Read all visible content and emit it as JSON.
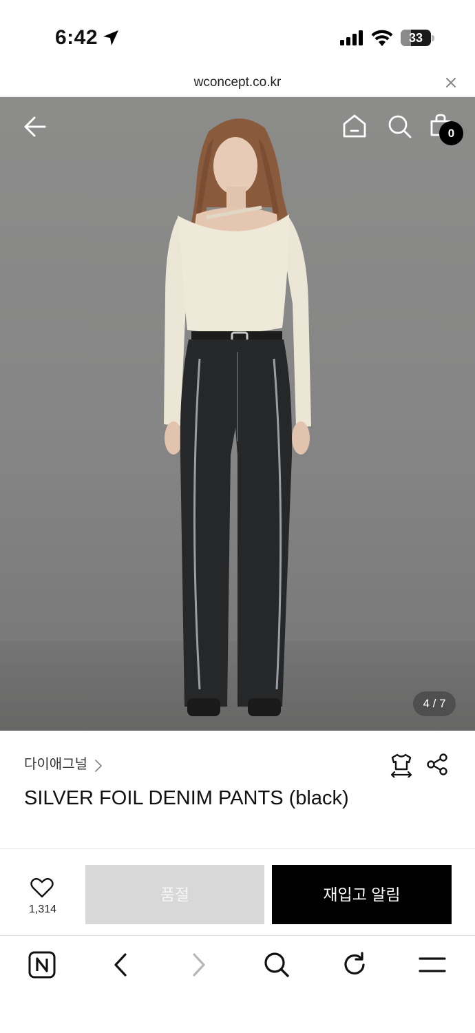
{
  "status_bar": {
    "time": "6:42",
    "battery_level": "33",
    "battery_fraction": 0.33
  },
  "browser": {
    "url": "wconcept.co.kr"
  },
  "hero": {
    "page_indicator": "4 / 7",
    "cart_count": "0",
    "image_alt": "Model wearing cream asymmetric knit top and black silver-foil wide denim pants"
  },
  "product": {
    "brand": "다이애그널",
    "name": "SILVER FOIL DENIM PANTS (black)"
  },
  "actions": {
    "wish_count": "1,314",
    "soldout_label": "품절",
    "restock_label": "재입고 알림"
  },
  "icons": {
    "back": "arrow-left-icon",
    "home": "home-icon",
    "search": "search-icon",
    "cart": "shopping-bag-icon",
    "fit": "shirt-size-icon",
    "share": "share-icon",
    "heart": "heart-icon",
    "naver": "naver-n-icon",
    "nav_back": "chevron-left-icon",
    "nav_forward": "chevron-right-icon",
    "refresh": "refresh-icon",
    "menu": "menu-icon"
  },
  "colors": {
    "soldout_bg": "#d8d8d8",
    "restock_bg": "#000000",
    "badge_bg": "#000000"
  }
}
